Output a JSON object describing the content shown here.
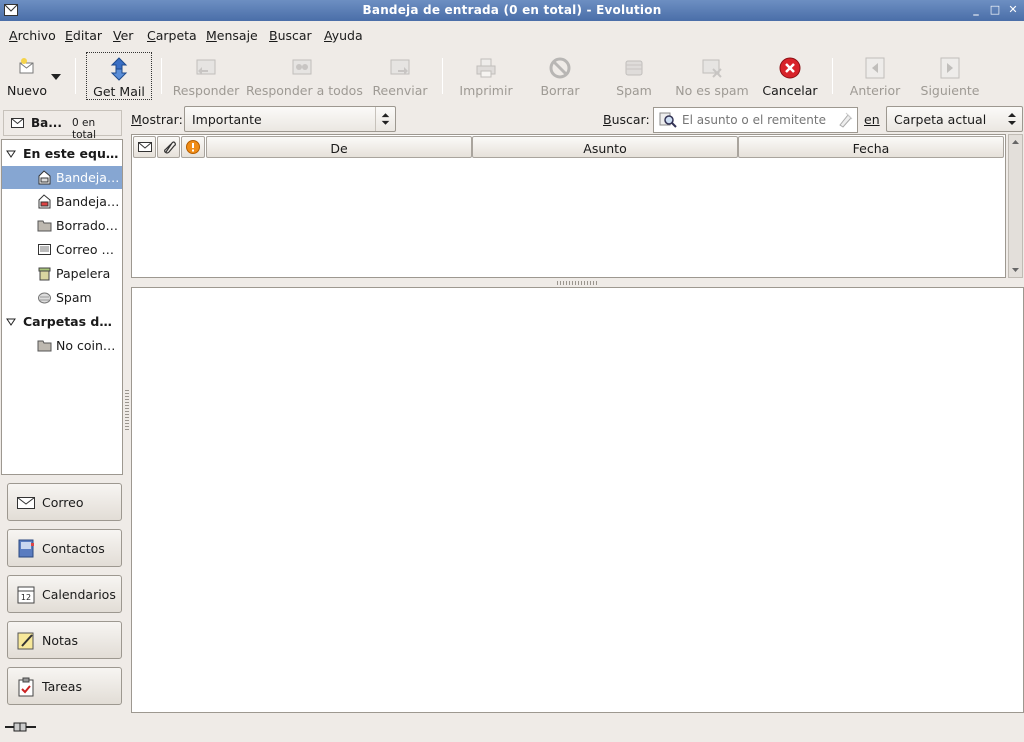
{
  "window": {
    "title": "Bandeja de entrada (0 en total) - Evolution",
    "buttons": [
      "minimize",
      "maximize",
      "close"
    ]
  },
  "menu": {
    "items": [
      "Archivo",
      "Editar",
      "Ver",
      "Carpeta",
      "Mensaje",
      "Buscar",
      "Ayuda"
    ]
  },
  "toolbar": {
    "nuevo": "Nuevo",
    "get_mail": "Get Mail",
    "responder": "Responder",
    "responder_todos": "Responder a todos",
    "reenviar": "Reenviar",
    "imprimir": "Imprimir",
    "borrar": "Borrar",
    "spam": "Spam",
    "no_spam": "No es spam",
    "cancelar": "Cancelar",
    "anterior": "Anterior",
    "siguiente": "Siguiente"
  },
  "sidebar": {
    "header_title": "Ba...",
    "header_count": "0 en total",
    "groups": [
      {
        "label": "En este equipo",
        "expanded": true
      },
      {
        "label": "Carpetas de búsqueda",
        "expanded": true
      }
    ],
    "folders": [
      {
        "label": "Bandeja de entrada",
        "icon": "inbox-icon",
        "selected": true
      },
      {
        "label": "Bandeja de salida",
        "icon": "outbox-icon",
        "selected": false
      },
      {
        "label": "Borradores",
        "icon": "folder-icon",
        "selected": false
      },
      {
        "label": "Correo enviado",
        "icon": "sent-icon",
        "selected": false
      },
      {
        "label": "Papelera",
        "icon": "trash-icon",
        "selected": false
      },
      {
        "label": "Spam",
        "icon": "spam-icon",
        "selected": false
      }
    ],
    "search_folders": [
      {
        "label": "No coincidentes",
        "icon": "folder-icon"
      }
    ]
  },
  "switcher": {
    "correo": "Correo",
    "contactos": "Contactos",
    "calendarios": "Calendarios",
    "notas": "Notas",
    "tareas": "Tareas",
    "calendar_icon_number": "12"
  },
  "filter": {
    "mostrar_label": "Mostrar:",
    "mostrar_value": "Importante",
    "buscar_label": "Buscar:",
    "search_placeholder": "El asunto o el remitente contienen",
    "en_label": "en",
    "scope_value": "Carpeta actual"
  },
  "message_list": {
    "columns": [
      "De",
      "Asunto",
      "Fecha"
    ],
    "rows": []
  },
  "colors": {
    "titlebar": "#4a6ea8",
    "selection": "#86a6d2",
    "background": "#efebe7",
    "cancel_red": "#d8232a"
  }
}
